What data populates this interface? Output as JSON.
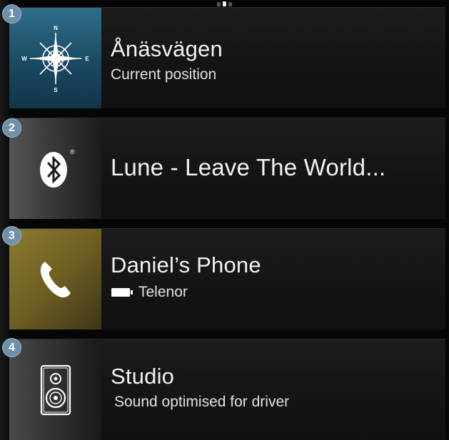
{
  "page_indicator": {
    "count": 3,
    "active_index": 1
  },
  "tiles": [
    {
      "badge": "1",
      "title": "Ånäsvägen",
      "subtitle": "Current position",
      "icon": "compass-rose-icon",
      "compass": {
        "n": "N",
        "s": "S",
        "e": "E",
        "w": "W"
      },
      "thumb_color": "#1b4a62"
    },
    {
      "badge": "2",
      "title": "Lune - Leave The World...",
      "icon": "bluetooth-icon",
      "registered_mark": "®",
      "thumb_color": "#3a3a3a"
    },
    {
      "badge": "3",
      "title": "Daniel’s Phone",
      "subtitle": "Telenor",
      "icon": "phone-handset-icon",
      "status_icon": "battery-icon",
      "thumb_color": "#6e5f22"
    },
    {
      "badge": "4",
      "title": "Studio",
      "subtitle": "Sound optimised for driver",
      "icon": "speaker-icon",
      "thumb_color": "#333333"
    }
  ],
  "colors": {
    "badge": "#6f90a8",
    "background": "#060606",
    "tile": "#151515",
    "text": "#f2f2f2"
  }
}
